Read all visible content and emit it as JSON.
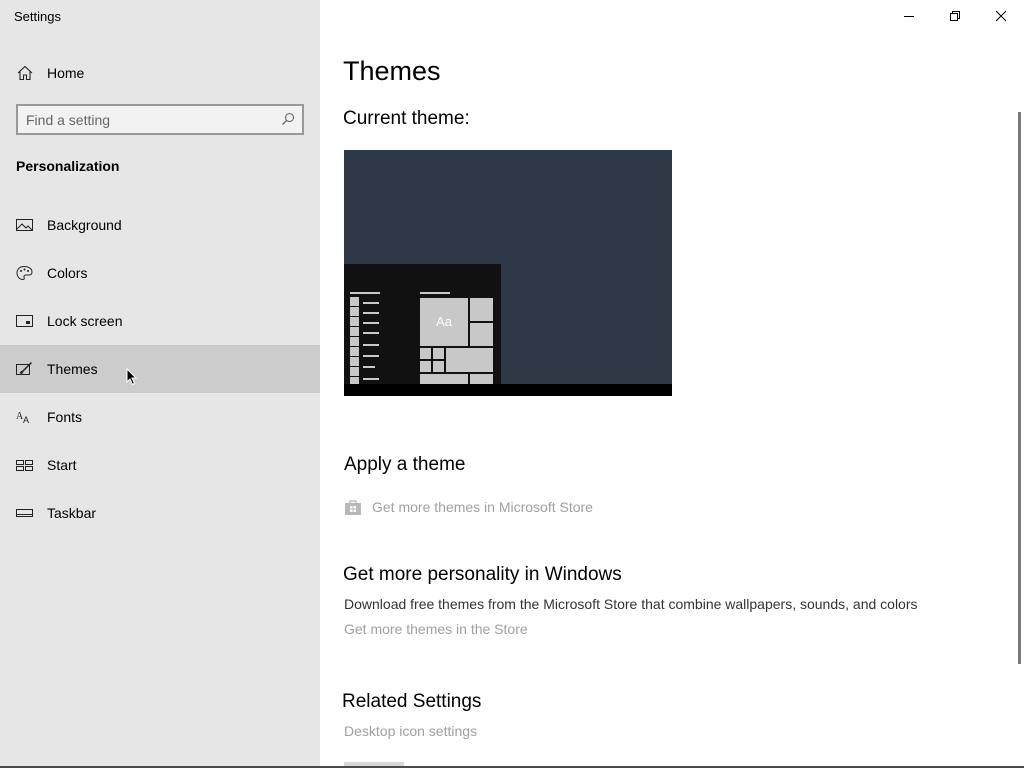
{
  "window": {
    "title": "Settings",
    "controls": [
      "minimize",
      "maximize",
      "close"
    ]
  },
  "sidebar": {
    "home_label": "Home",
    "search_placeholder": "Find a setting",
    "section_title": "Personalization",
    "items": [
      {
        "label": "Background",
        "icon": "image-icon"
      },
      {
        "label": "Colors",
        "icon": "palette-icon"
      },
      {
        "label": "Lock screen",
        "icon": "lock-screen-icon"
      },
      {
        "label": "Themes",
        "icon": "themes-icon",
        "selected": true
      },
      {
        "label": "Fonts",
        "icon": "fonts-icon"
      },
      {
        "label": "Start",
        "icon": "start-icon"
      },
      {
        "label": "Taskbar",
        "icon": "taskbar-icon"
      }
    ]
  },
  "main": {
    "title": "Themes",
    "current_theme_label": "Current theme:",
    "preview": {
      "tile_text": "Aa",
      "background_color": "#2f3847"
    },
    "apply_theme_heading": "Apply a theme",
    "store_link": "Get more themes in Microsoft Store",
    "personality_heading": "Get more personality in Windows",
    "personality_description": "Download free themes from the Microsoft Store that combine wallpapers, sounds, and colors",
    "personality_link": "Get more themes in the Store",
    "related_heading": "Related Settings",
    "related_links": [
      "Desktop icon settings"
    ]
  },
  "colors": {
    "sidebar_bg": "#e6e6e6",
    "selected_item_bg": "#cccccc",
    "link_disabled": "#a0a0a0"
  }
}
